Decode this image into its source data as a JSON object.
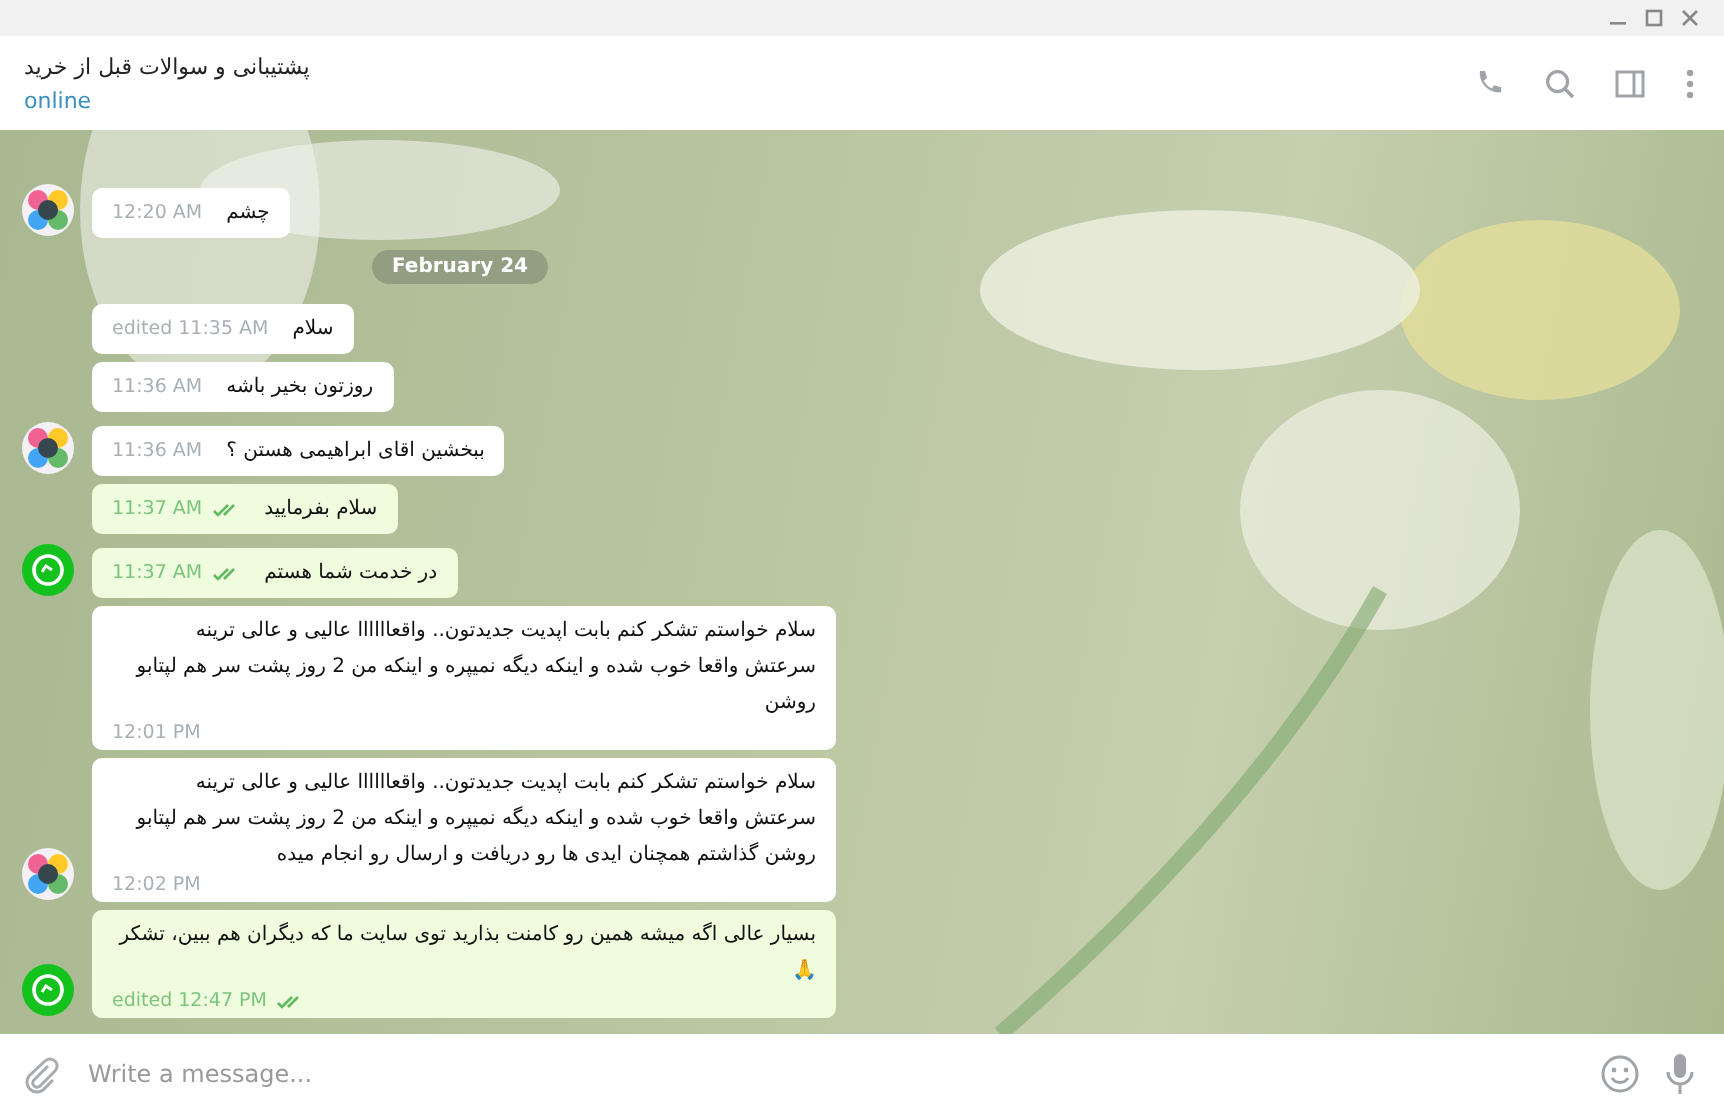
{
  "chat": {
    "title": "پشتیبانی و سوالات قبل از خرید",
    "status": "online"
  },
  "messages": [
    {
      "kind": "message",
      "outgoing": false,
      "show_avatar": true,
      "paragraphs": [
        "چشم"
      ],
      "time": "12:20 AM",
      "read": false
    },
    {
      "kind": "date",
      "label": "February 24"
    },
    {
      "kind": "message",
      "outgoing": false,
      "show_avatar": false,
      "paragraphs": [
        "سلام"
      ],
      "time": "edited 11:35 AM",
      "read": false
    },
    {
      "kind": "message",
      "outgoing": false,
      "show_avatar": false,
      "paragraphs": [
        "روزتون بخیر باشه"
      ],
      "time": "11:36 AM",
      "read": false
    },
    {
      "kind": "message",
      "outgoing": false,
      "show_avatar": true,
      "paragraphs": [
        "ببخشین اقای ابراهیمی هستن ؟"
      ],
      "time": "11:36 AM",
      "read": false
    },
    {
      "kind": "message",
      "outgoing": true,
      "show_avatar": false,
      "paragraphs": [
        "سلام بفرمایید"
      ],
      "time": "11:37 AM",
      "read": true
    },
    {
      "kind": "message",
      "outgoing": true,
      "show_avatar": true,
      "paragraphs": [
        "در خدمت شما هستم"
      ],
      "time": "11:37 AM",
      "read": true
    },
    {
      "kind": "message",
      "outgoing": false,
      "show_avatar": false,
      "paragraphs": [
        "سلام خواستم تشکر کنم بابت اپدیت جدیدتون.. واقعاااااا عالیی و عالی ترینه",
        "سرعتش واقعا خوب شده و اینکه دیگه نمیپره و اینکه من 2 روز پشت سر هم لپتابو روشن"
      ],
      "time": "12:01 PM",
      "read": false
    },
    {
      "kind": "message",
      "outgoing": false,
      "show_avatar": true,
      "paragraphs": [
        "سلام خواستم تشکر کنم بابت اپدیت جدیدتون.. واقعاااااا عالیی و عالی ترینه",
        "سرعتش واقعا خوب شده و اینکه دیگه نمیپره و اینکه من 2 روز پشت سر هم لپتابو روشن گذاشتم همچنان ایدی ها رو دریافت و ارسال رو انجام میده"
      ],
      "time": "12:02 PM",
      "read": false
    },
    {
      "kind": "message",
      "outgoing": true,
      "show_avatar": true,
      "paragraphs": [
        "بسیار عالی اگه میشه همین رو کامنت بذارید توی سایت ما که دیگران هم ببین، تشکر 🙏"
      ],
      "time": "edited 12:47 PM",
      "read": true
    }
  ],
  "composer": {
    "placeholder": "Write a message..."
  }
}
